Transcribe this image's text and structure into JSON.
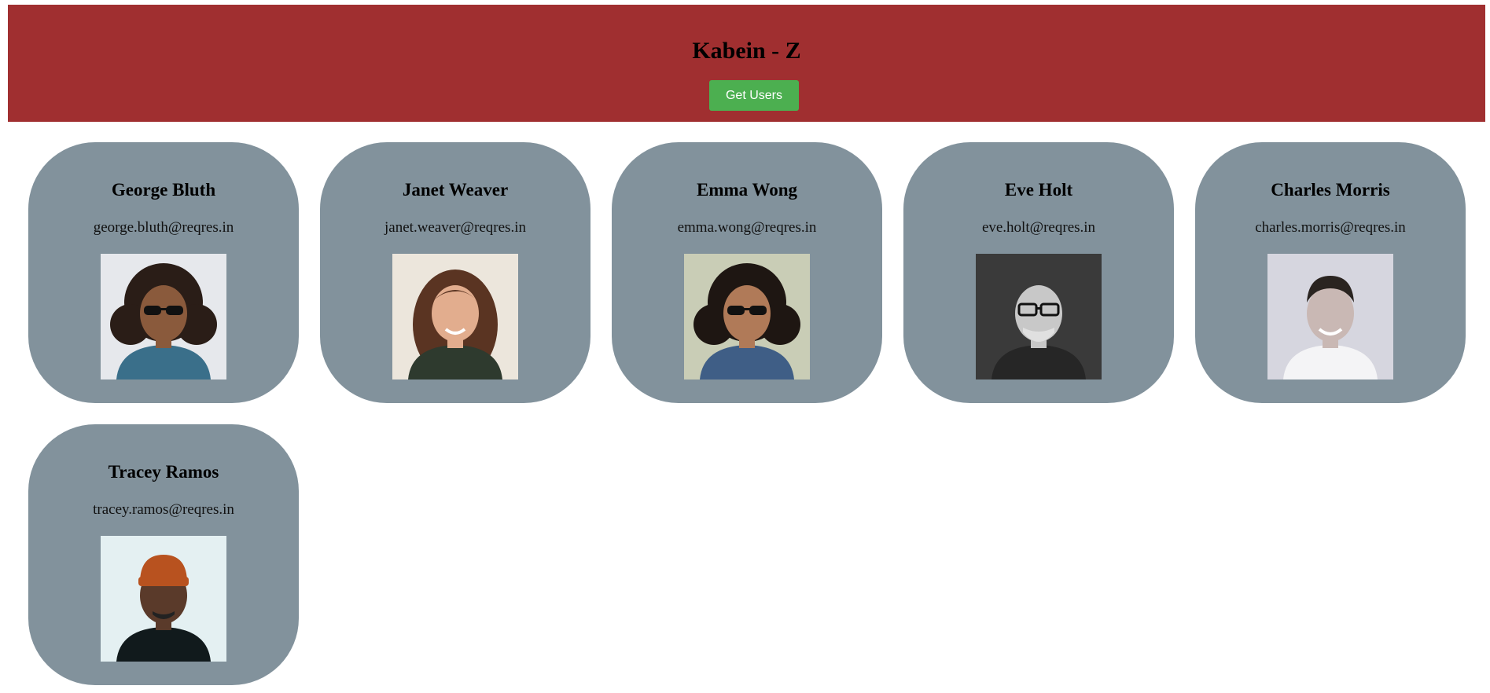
{
  "header": {
    "title": "Kabein - Z",
    "button_label": "Get Users",
    "background_color": "#a02f30",
    "button_color": "#4caf50"
  },
  "card_color": "#82929c",
  "users": [
    {
      "name": "George Bluth",
      "email": "george.bluth@reqres.in",
      "avatar": {
        "bg": "#e6e8ec",
        "skin": "#8a5a3c",
        "hair": "#2a1d17",
        "shirt": "#3a6f8a",
        "style": "curly-sunglasses"
      }
    },
    {
      "name": "Janet Weaver",
      "email": "janet.weaver@reqres.in",
      "avatar": {
        "bg": "#ece6dc",
        "skin": "#e2ad8e",
        "hair": "#5a3422",
        "shirt": "#2e3a2e",
        "style": "long-hair"
      }
    },
    {
      "name": "Emma Wong",
      "email": "emma.wong@reqres.in",
      "avatar": {
        "bg": "#c9cdb6",
        "skin": "#b07a58",
        "hair": "#1e1612",
        "shirt": "#3f5e86",
        "style": "curly-sunglasses"
      }
    },
    {
      "name": "Eve Holt",
      "email": "eve.holt@reqres.in",
      "avatar": {
        "bg": "#3a3a3a",
        "skin": "#c8c8c8",
        "hair": "#d8d8d8",
        "shirt": "#262626",
        "style": "bald-glasses"
      }
    },
    {
      "name": "Charles Morris",
      "email": "charles.morris@reqres.in",
      "avatar": {
        "bg": "#d6d6df",
        "skin": "#c9b8b4",
        "hair": "#2a2420",
        "shirt": "#f4f4f6",
        "style": "short-hair"
      }
    },
    {
      "name": "Tracey Ramos",
      "email": "tracey.ramos@reqres.in",
      "avatar": {
        "bg": "#e4f0f2",
        "skin": "#5a3a2a",
        "hair": "#b8521f",
        "shirt": "#111a1c",
        "style": "beanie"
      }
    }
  ]
}
